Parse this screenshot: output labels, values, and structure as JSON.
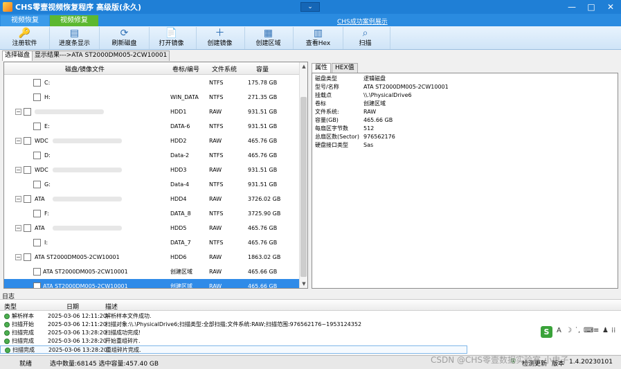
{
  "window": {
    "title": "CHS零壹视频恢复程序 高级版(永久)",
    "minimize": "—",
    "maximize": "□",
    "close": "✕",
    "dropdown": "⌄"
  },
  "main_tabs": [
    "视频恢复",
    "视频修复"
  ],
  "help_link": "CHS成功案例展示",
  "toolbar": [
    {
      "label": "注册软件",
      "icon": "key-icon",
      "glyph": "🔑"
    },
    {
      "label": "进度条显示",
      "icon": "progress-icon",
      "glyph": "▤"
    },
    {
      "label": "刷新磁盘",
      "icon": "refresh-disk-icon",
      "glyph": "⟳"
    },
    {
      "label": "打开镜像",
      "icon": "open-image-icon",
      "glyph": "📄"
    },
    {
      "label": "创建镜像",
      "icon": "create-image-icon",
      "glyph": "＋"
    },
    {
      "label": "创建区域",
      "icon": "create-region-icon",
      "glyph": "▦"
    },
    {
      "label": "查看Hex",
      "icon": "hex-icon",
      "glyph": "▥"
    },
    {
      "label": "扫描",
      "icon": "scan-icon",
      "glyph": "⌕"
    }
  ],
  "sub_tabs": [
    "选择磁盘",
    "显示结果--->ATA    ST2000DM005-2CW10001"
  ],
  "disk_table": {
    "columns": [
      "磁盘/镜像文件",
      "卷标/编号",
      "文件系统",
      "容量"
    ],
    "rows": [
      {
        "level": 1,
        "name": "C:",
        "label": "",
        "fs": "NTFS",
        "size": "175.78 GB",
        "blurred": false
      },
      {
        "level": 1,
        "name": "H:",
        "label": "WIN_DATA",
        "fs": "NTFS",
        "size": "271.35 GB",
        "blurred": false
      },
      {
        "level": 0,
        "name": "",
        "label": "HDD1",
        "fs": "RAW",
        "size": "931.51 GB",
        "blurred": true
      },
      {
        "level": 1,
        "name": "E:",
        "label": "DATA-6",
        "fs": "NTFS",
        "size": "931.51 GB",
        "blurred": false
      },
      {
        "level": 0,
        "name": "WDC",
        "label": "HDD2",
        "fs": "RAW",
        "size": "465.76 GB",
        "blurred": true
      },
      {
        "level": 1,
        "name": "D:",
        "label": "Data-2",
        "fs": "NTFS",
        "size": "465.76 GB",
        "blurred": false
      },
      {
        "level": 0,
        "name": "WDC",
        "label": "HDD3",
        "fs": "RAW",
        "size": "931.51 GB",
        "blurred": true
      },
      {
        "level": 1,
        "name": "G:",
        "label": "Data-4",
        "fs": "NTFS",
        "size": "931.51 GB",
        "blurred": false
      },
      {
        "level": 0,
        "name": "ATA",
        "label": "HDD4",
        "fs": "RAW",
        "size": "3726.02 GB",
        "blurred": true
      },
      {
        "level": 1,
        "name": "F:",
        "label": "DATA_8",
        "fs": "NTFS",
        "size": "3725.90 GB",
        "blurred": false
      },
      {
        "level": 0,
        "name": "ATA",
        "label": "HDD5",
        "fs": "RAW",
        "size": "465.76 GB",
        "blurred": true
      },
      {
        "level": 1,
        "name": "I:",
        "label": "DATA_7",
        "fs": "NTFS",
        "size": "465.76 GB",
        "blurred": false
      },
      {
        "level": 0,
        "name": "ATA     ST2000DM005-2CW10001",
        "label": "HDD6",
        "fs": "RAW",
        "size": "1863.02 GB",
        "blurred": false
      },
      {
        "level": 1,
        "name": "ATA     ST2000DM005-2CW10001",
        "label": "创建区域",
        "fs": "RAW",
        "size": "465.66 GB",
        "blurred": false
      },
      {
        "level": 1,
        "name": "ATA     ST2000DM005-2CW10001",
        "label": "创建区域",
        "fs": "RAW",
        "size": "465.66 GB",
        "blurred": false,
        "selected": true
      }
    ]
  },
  "right_tabs": [
    "属性",
    "HEX值"
  ],
  "properties": [
    {
      "key": "磁盘类型",
      "value": "逻辑磁盘"
    },
    {
      "key": "型号/名称",
      "value": "ATA     ST2000DM005-2CW10001"
    },
    {
      "key": "挂载点",
      "value": "\\\\.\\PhysicalDrive6"
    },
    {
      "key": "卷标",
      "value": "创建区域"
    },
    {
      "key": "文件系统:",
      "value": "RAW"
    },
    {
      "key": "容量(GB)",
      "value": "465.66 GB"
    },
    {
      "key": "每扇区字节数",
      "value": "512"
    },
    {
      "key": "总扇区数(Sector)",
      "value": "976562176"
    },
    {
      "key": "硬盘接口类型",
      "value": "Sas"
    }
  ],
  "log": {
    "label": "日志",
    "columns": [
      "类型",
      "日期",
      "描述"
    ],
    "rows": [
      {
        "type": "解析样本",
        "date": "2025-03-06 12:11:20",
        "desc": "解析样本文件成功."
      },
      {
        "type": "扫描开始",
        "date": "2025-03-06 12:11:20",
        "desc": "扫描对象:\\\\.\\PhysicalDrive6;扫描类型:全部扫描;文件系统:RAW;扫描范围:976562176~1953124352"
      },
      {
        "type": "扫描完成",
        "date": "2025-03-06 13:28:20",
        "desc": "扫描成功完成!"
      },
      {
        "type": "扫描完成",
        "date": "2025-03-06 13:28:20",
        "desc": "开始重组碎片."
      },
      {
        "type": "扫描完成",
        "date": "2025-03-06 13:28:20",
        "desc": "重组碎片完成."
      }
    ]
  },
  "ime": {
    "logo": "S",
    "items": [
      "A",
      "☽",
      "˙,",
      "⌨",
      "≡",
      "♟",
      "⁞⁞"
    ]
  },
  "status": {
    "ready": "就绪",
    "selection": "选中数量:68145 选中容量:457.40 GB",
    "check_update": "检测更新",
    "version_label": "版本",
    "version": "1.4.20230101"
  },
  "watermark": "CSDN @CHS零壹数据实验室-小电子",
  "colors": {
    "titlebar": "#1f7fd6",
    "selected_row": "#2f8be8",
    "repair_tab": "#5cb830"
  }
}
